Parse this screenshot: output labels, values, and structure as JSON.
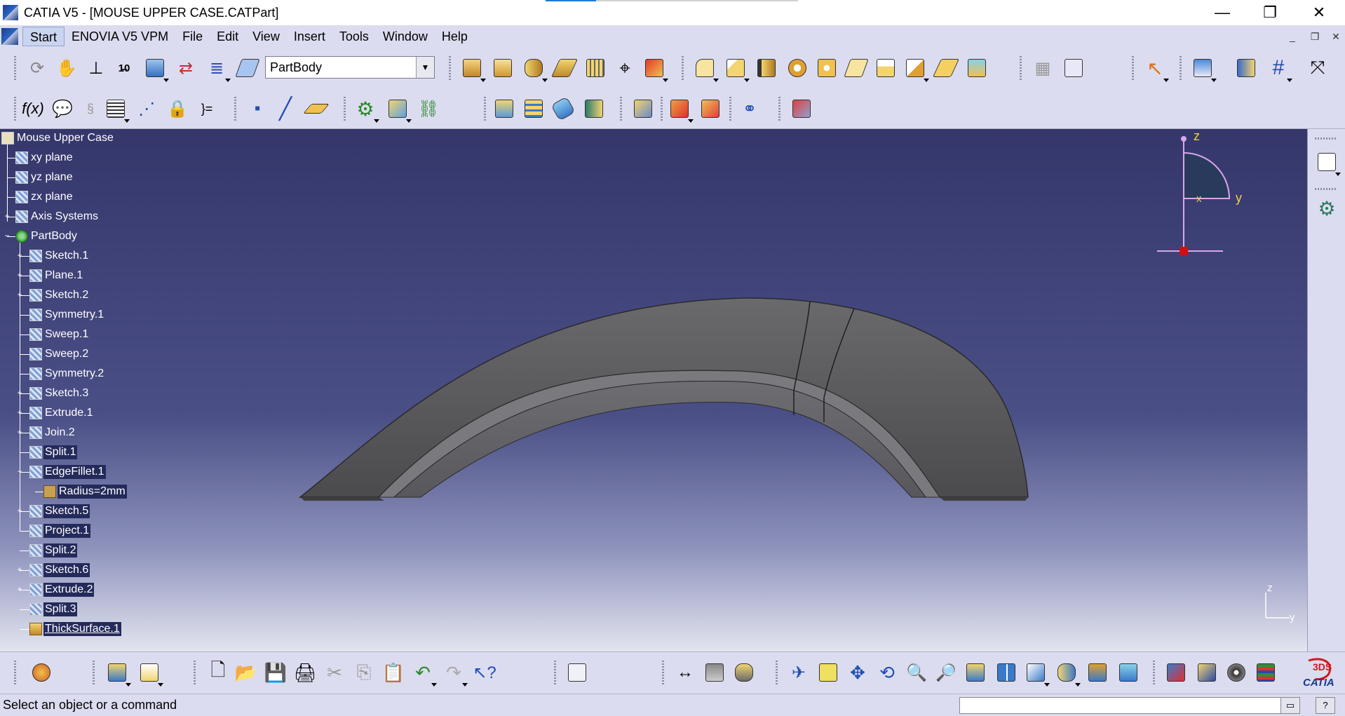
{
  "window": {
    "title": "CATIA V5 - [MOUSE UPPER CASE.CATPart]",
    "minimize_glyph": "—",
    "restore_glyph": "❐",
    "close_glyph": "✕"
  },
  "menu": {
    "items": [
      "Start",
      "ENOVIA V5 VPM",
      "File",
      "Edit",
      "View",
      "Insert",
      "Tools",
      "Window",
      "Help"
    ]
  },
  "toolbar": {
    "workbench_value": "PartBody"
  },
  "tree": {
    "root": "Mouse Upper Case",
    "items": [
      {
        "label": "xy plane",
        "level": 1,
        "icon": "plane-icon"
      },
      {
        "label": "yz plane",
        "level": 1,
        "icon": "plane-icon"
      },
      {
        "label": "zx plane",
        "level": 1,
        "icon": "plane-icon"
      },
      {
        "label": "Axis Systems",
        "level": 1,
        "icon": "axis-system-icon"
      },
      {
        "label": "PartBody",
        "level": 1,
        "icon": "partbody-icon"
      },
      {
        "label": "Sketch.1",
        "level": 2,
        "icon": "sketch-icon"
      },
      {
        "label": "Plane.1",
        "level": 2,
        "icon": "plane-icon"
      },
      {
        "label": "Sketch.2",
        "level": 2,
        "icon": "sketch-icon"
      },
      {
        "label": "Symmetry.1",
        "level": 2,
        "icon": "symmetry-icon"
      },
      {
        "label": "Sweep.1",
        "level": 2,
        "icon": "sweep-icon"
      },
      {
        "label": "Sweep.2",
        "level": 2,
        "icon": "sweep-icon"
      },
      {
        "label": "Symmetry.2",
        "level": 2,
        "icon": "symmetry-icon"
      },
      {
        "label": "Sketch.3",
        "level": 2,
        "icon": "sketch-icon"
      },
      {
        "label": "Extrude.1",
        "level": 2,
        "icon": "extrude-icon"
      },
      {
        "label": "Join.2",
        "level": 2,
        "icon": "join-icon"
      },
      {
        "label": "Split.1",
        "level": 2,
        "icon": "split-icon"
      },
      {
        "label": "EdgeFillet.1",
        "level": 2,
        "icon": "edge-fillet-icon"
      },
      {
        "label": "Radius=2mm",
        "level": 3,
        "icon": "parameter-icon"
      },
      {
        "label": "Sketch.5",
        "level": 2,
        "icon": "sketch-icon"
      },
      {
        "label": "Project.1",
        "level": 2,
        "icon": "project-icon"
      },
      {
        "label": "Split.2",
        "level": 2,
        "icon": "split-icon"
      },
      {
        "label": "Sketch.6",
        "level": 2,
        "icon": "sketch-icon"
      },
      {
        "label": "Extrude.2",
        "level": 2,
        "icon": "extrude-icon"
      },
      {
        "label": "Split.3",
        "level": 2,
        "icon": "split-icon"
      },
      {
        "label": "ThickSurface.1",
        "level": 2,
        "icon": "thick-surface-icon"
      }
    ]
  },
  "compass": {
    "z_label": "z",
    "y_label": "y",
    "x_label": "x"
  },
  "mini_axis": {
    "z_label": "z",
    "y_label": "y"
  },
  "status": {
    "message": "Select an object or a command"
  },
  "colors": {
    "background_top": "#35376b",
    "background_bottom": "#e3e4ef",
    "model": "#5b5b5e",
    "selection_bg": "#242a5a",
    "compass_fill": "#2a3a5c",
    "compass_axis": "#d8a8e8",
    "axis_label": "#f0d040"
  },
  "logo": {
    "text": "CATIA",
    "mark": "3DS"
  }
}
